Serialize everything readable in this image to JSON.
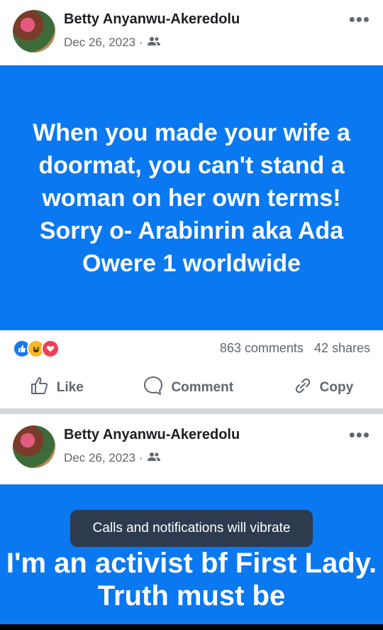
{
  "post1": {
    "author": "Betty Anyanwu-Akeredolu",
    "date": "Dec 26, 2023 ·",
    "text": "When you made your wife a doormat, you can't stand a woman on her own terms! Sorry o- Arabinrin aka Ada Owere 1 worldwide",
    "comments": "863 comments",
    "shares": "42 shares",
    "like_label": "Like",
    "comment_label": "Comment",
    "copy_label": "Copy"
  },
  "post2": {
    "author": "Betty Anyanwu-Akeredolu",
    "date": "Dec 26, 2023 ·",
    "text": "I'm an activist bf First Lady. Truth must be"
  },
  "toast": {
    "text": "Calls and notifications will vibrate"
  },
  "icons": {
    "audience": "friends-icon",
    "more": "more-dots-icon",
    "like": "thumbs-up-icon",
    "comment": "comment-bubble-icon",
    "copy": "link-icon"
  },
  "colors": {
    "banner": "#0a78f0",
    "toast": "#2e3b4e",
    "text": "#606770"
  }
}
